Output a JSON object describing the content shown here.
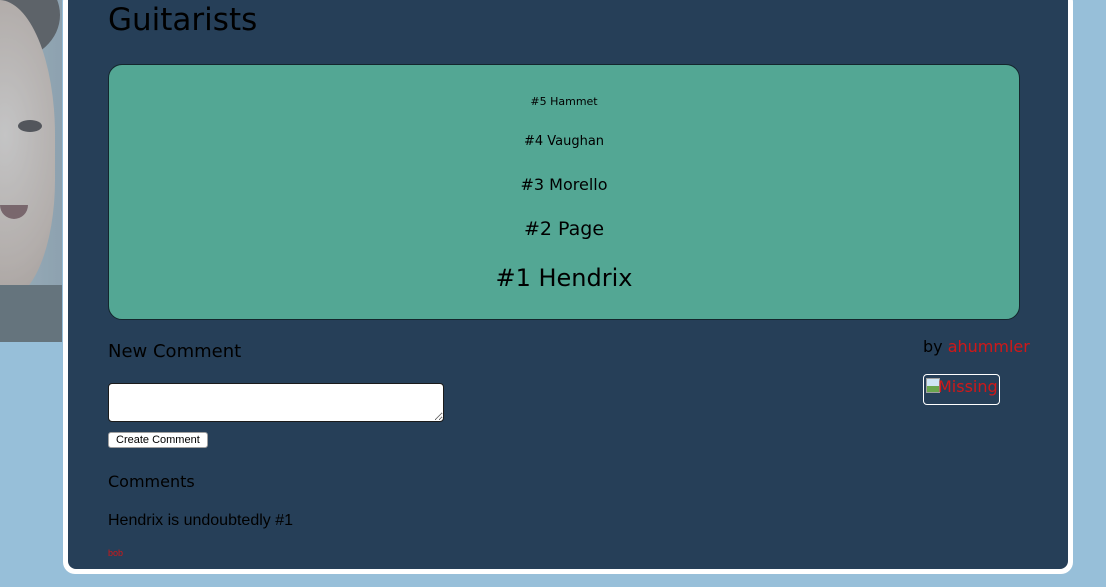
{
  "page": {
    "title": "Guitarists"
  },
  "rankings": [
    {
      "label": "#5 Hammet"
    },
    {
      "label": "#4 Vaughan"
    },
    {
      "label": "#3 Morello"
    },
    {
      "label": "#2 Page"
    },
    {
      "label": "#1 Hendrix"
    }
  ],
  "new_comment": {
    "heading": "New Comment",
    "textarea_value": "",
    "submit_label": "Create Comment"
  },
  "comments_section": {
    "heading": "Comments",
    "items": [
      {
        "text": "Hendrix is undoubtedly #1",
        "author": "bob"
      }
    ]
  },
  "byline": {
    "prefix": "by",
    "author": "ahummler",
    "image_alt": "Missing"
  },
  "colors": {
    "page_bg": "#97bfd9",
    "panel_bg": "#263f58",
    "rank_box_bg": "#53a794",
    "link": "#d01818"
  },
  "icons": {
    "broken_image": "broken-image-icon"
  }
}
